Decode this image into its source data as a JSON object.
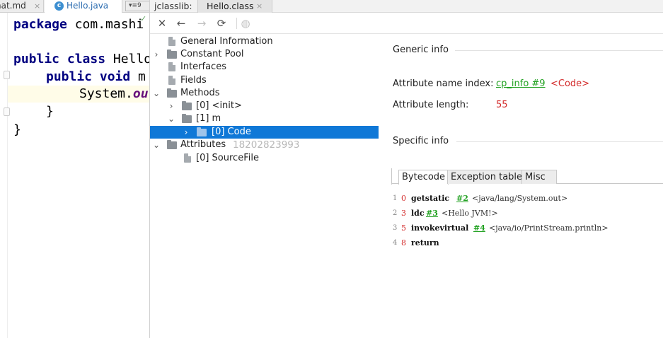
{
  "editor": {
    "tabs": [
      {
        "label": "nat.md",
        "close": "×"
      },
      {
        "label": "Hello.java",
        "close": "×",
        "icon_letter": "c"
      },
      {
        "label": "▾≡9"
      }
    ],
    "code": {
      "l1a": "package",
      "l1b": " com.mashi",
      "l2a": "public class",
      "l2b": " Hello",
      "l3a": "public void",
      "l3b": " m",
      "l4a": "System.",
      "l4b": "ou",
      "l5": "}",
      "l6": "}"
    }
  },
  "panel": {
    "label": "jclasslib:",
    "tab": {
      "label": "Hello.class",
      "close": "×"
    },
    "toolbar": {
      "close": "✕",
      "back": "←",
      "forward": "→",
      "refresh": "⟳",
      "web": "◍"
    },
    "tree": {
      "general": "General Information",
      "constant_pool": "Constant Pool",
      "interfaces": "Interfaces",
      "fields": "Fields",
      "methods": "Methods",
      "init": "[0] <init>",
      "m": "[1] m",
      "code": "[0] Code",
      "attributes": "Attributes",
      "sourcefile": "[0] SourceFile",
      "watermark": "18202823993",
      "arrow_collapsed": "›",
      "arrow_expanded": "⌄"
    },
    "detail": {
      "generic_title": "Generic info",
      "attr_name_label": "Attribute name index:",
      "attr_name_link": "cp_info #9",
      "attr_name_value": "<Code>",
      "attr_length_label": "Attribute length:",
      "attr_length_value": "55",
      "specific_title": "Specific info",
      "tabs": [
        "Bytecode",
        "Exception table",
        "Misc"
      ],
      "bytecode": [
        {
          "line": "1",
          "offset": "0",
          "op": "getstatic",
          "ref": "#2",
          "comment": "<java/lang/System.out>"
        },
        {
          "line": "2",
          "offset": "3",
          "op": "ldc",
          "ref": "#3",
          "comment": "<Hello JVM!>"
        },
        {
          "line": "3",
          "offset": "5",
          "op": "invokevirtual",
          "ref": "#4",
          "comment": "<java/io/PrintStream.println>"
        },
        {
          "line": "4",
          "offset": "8",
          "op": "return",
          "ref": "",
          "comment": ""
        }
      ]
    }
  }
}
